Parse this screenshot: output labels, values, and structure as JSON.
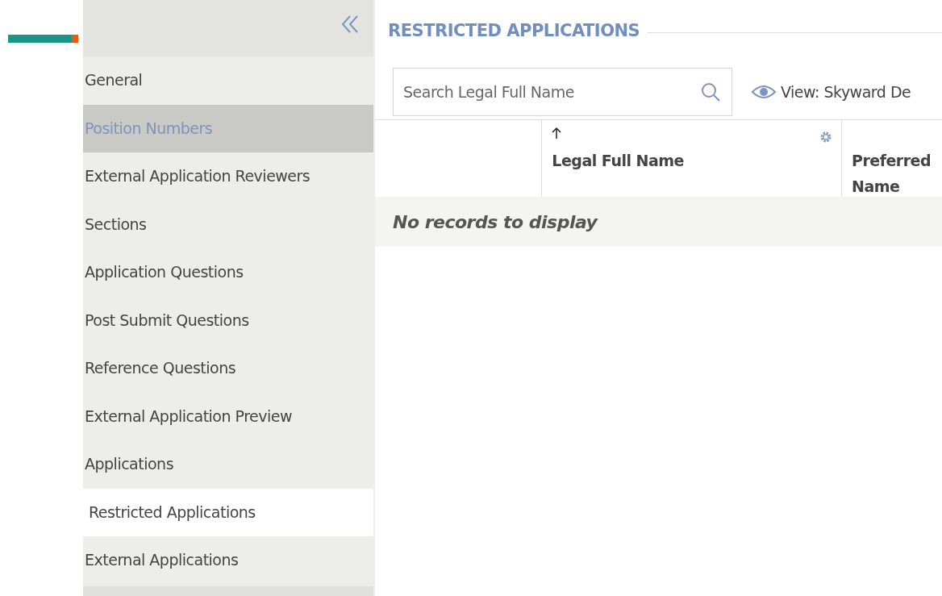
{
  "sidebar": {
    "items": [
      {
        "label": "General",
        "selected": false,
        "highlighted": false
      },
      {
        "label": "Position Numbers",
        "selected": false,
        "highlighted": true
      },
      {
        "label": "External Application Reviewers",
        "selected": false,
        "highlighted": false
      },
      {
        "label": "Sections",
        "selected": false,
        "highlighted": false
      },
      {
        "label": "Application Questions",
        "selected": false,
        "highlighted": false
      },
      {
        "label": "Post Submit Questions",
        "selected": false,
        "highlighted": false
      },
      {
        "label": "Reference Questions",
        "selected": false,
        "highlighted": false
      },
      {
        "label": "External Application Preview",
        "selected": false,
        "highlighted": false
      },
      {
        "label": "Applications",
        "selected": false,
        "highlighted": false
      },
      {
        "label": "Restricted Applications",
        "selected": true,
        "highlighted": false
      },
      {
        "label": "External Applications",
        "selected": false,
        "highlighted": false
      }
    ]
  },
  "main": {
    "title": "RESTRICTED APPLICATIONS",
    "search": {
      "placeholder": "Search Legal Full Name"
    },
    "view": {
      "label": "View: Skyward De"
    },
    "table": {
      "columns": [
        {
          "label": "Legal Full Name",
          "sorted": true,
          "settings": true
        },
        {
          "label": "Preferred Name",
          "sorted": false,
          "settings": false
        }
      ],
      "empty_message": "No records to display"
    }
  }
}
